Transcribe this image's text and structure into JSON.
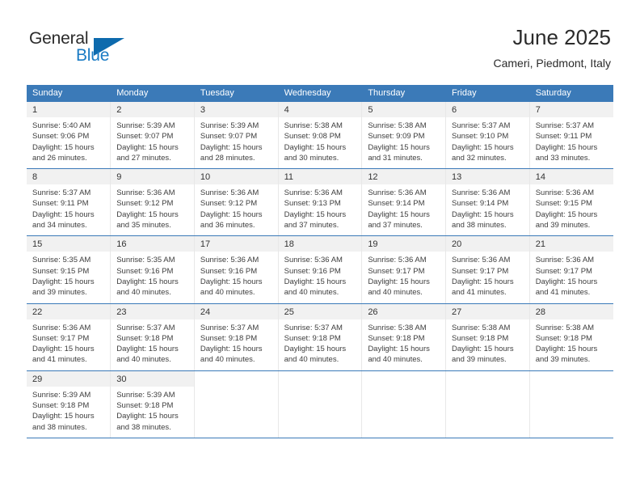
{
  "brand": {
    "name_part1": "General",
    "name_part2": "Blue",
    "logo_icon": "triangle-logo-icon",
    "accent_color": "#1a7bc4"
  },
  "header": {
    "title": "June 2025",
    "subtitle": "Cameri, Piedmont, Italy"
  },
  "theme": {
    "header_row_bg": "#3b7ab8",
    "daynum_bg": "#f1f1f1",
    "row_divider": "#3b7ab8",
    "text": "#3d3d3d"
  },
  "calendar": {
    "weekday_headers": [
      "Sunday",
      "Monday",
      "Tuesday",
      "Wednesday",
      "Thursday",
      "Friday",
      "Saturday"
    ],
    "weeks": [
      [
        {
          "day": "1",
          "sunrise": "Sunrise: 5:40 AM",
          "sunset": "Sunset: 9:06 PM",
          "daylight_line1": "Daylight: 15 hours",
          "daylight_line2": "and 26 minutes."
        },
        {
          "day": "2",
          "sunrise": "Sunrise: 5:39 AM",
          "sunset": "Sunset: 9:07 PM",
          "daylight_line1": "Daylight: 15 hours",
          "daylight_line2": "and 27 minutes."
        },
        {
          "day": "3",
          "sunrise": "Sunrise: 5:39 AM",
          "sunset": "Sunset: 9:07 PM",
          "daylight_line1": "Daylight: 15 hours",
          "daylight_line2": "and 28 minutes."
        },
        {
          "day": "4",
          "sunrise": "Sunrise: 5:38 AM",
          "sunset": "Sunset: 9:08 PM",
          "daylight_line1": "Daylight: 15 hours",
          "daylight_line2": "and 30 minutes."
        },
        {
          "day": "5",
          "sunrise": "Sunrise: 5:38 AM",
          "sunset": "Sunset: 9:09 PM",
          "daylight_line1": "Daylight: 15 hours",
          "daylight_line2": "and 31 minutes."
        },
        {
          "day": "6",
          "sunrise": "Sunrise: 5:37 AM",
          "sunset": "Sunset: 9:10 PM",
          "daylight_line1": "Daylight: 15 hours",
          "daylight_line2": "and 32 minutes."
        },
        {
          "day": "7",
          "sunrise": "Sunrise: 5:37 AM",
          "sunset": "Sunset: 9:11 PM",
          "daylight_line1": "Daylight: 15 hours",
          "daylight_line2": "and 33 minutes."
        }
      ],
      [
        {
          "day": "8",
          "sunrise": "Sunrise: 5:37 AM",
          "sunset": "Sunset: 9:11 PM",
          "daylight_line1": "Daylight: 15 hours",
          "daylight_line2": "and 34 minutes."
        },
        {
          "day": "9",
          "sunrise": "Sunrise: 5:36 AM",
          "sunset": "Sunset: 9:12 PM",
          "daylight_line1": "Daylight: 15 hours",
          "daylight_line2": "and 35 minutes."
        },
        {
          "day": "10",
          "sunrise": "Sunrise: 5:36 AM",
          "sunset": "Sunset: 9:12 PM",
          "daylight_line1": "Daylight: 15 hours",
          "daylight_line2": "and 36 minutes."
        },
        {
          "day": "11",
          "sunrise": "Sunrise: 5:36 AM",
          "sunset": "Sunset: 9:13 PM",
          "daylight_line1": "Daylight: 15 hours",
          "daylight_line2": "and 37 minutes."
        },
        {
          "day": "12",
          "sunrise": "Sunrise: 5:36 AM",
          "sunset": "Sunset: 9:14 PM",
          "daylight_line1": "Daylight: 15 hours",
          "daylight_line2": "and 37 minutes."
        },
        {
          "day": "13",
          "sunrise": "Sunrise: 5:36 AM",
          "sunset": "Sunset: 9:14 PM",
          "daylight_line1": "Daylight: 15 hours",
          "daylight_line2": "and 38 minutes."
        },
        {
          "day": "14",
          "sunrise": "Sunrise: 5:36 AM",
          "sunset": "Sunset: 9:15 PM",
          "daylight_line1": "Daylight: 15 hours",
          "daylight_line2": "and 39 minutes."
        }
      ],
      [
        {
          "day": "15",
          "sunrise": "Sunrise: 5:35 AM",
          "sunset": "Sunset: 9:15 PM",
          "daylight_line1": "Daylight: 15 hours",
          "daylight_line2": "and 39 minutes."
        },
        {
          "day": "16",
          "sunrise": "Sunrise: 5:35 AM",
          "sunset": "Sunset: 9:16 PM",
          "daylight_line1": "Daylight: 15 hours",
          "daylight_line2": "and 40 minutes."
        },
        {
          "day": "17",
          "sunrise": "Sunrise: 5:36 AM",
          "sunset": "Sunset: 9:16 PM",
          "daylight_line1": "Daylight: 15 hours",
          "daylight_line2": "and 40 minutes."
        },
        {
          "day": "18",
          "sunrise": "Sunrise: 5:36 AM",
          "sunset": "Sunset: 9:16 PM",
          "daylight_line1": "Daylight: 15 hours",
          "daylight_line2": "and 40 minutes."
        },
        {
          "day": "19",
          "sunrise": "Sunrise: 5:36 AM",
          "sunset": "Sunset: 9:17 PM",
          "daylight_line1": "Daylight: 15 hours",
          "daylight_line2": "and 40 minutes."
        },
        {
          "day": "20",
          "sunrise": "Sunrise: 5:36 AM",
          "sunset": "Sunset: 9:17 PM",
          "daylight_line1": "Daylight: 15 hours",
          "daylight_line2": "and 41 minutes."
        },
        {
          "day": "21",
          "sunrise": "Sunrise: 5:36 AM",
          "sunset": "Sunset: 9:17 PM",
          "daylight_line1": "Daylight: 15 hours",
          "daylight_line2": "and 41 minutes."
        }
      ],
      [
        {
          "day": "22",
          "sunrise": "Sunrise: 5:36 AM",
          "sunset": "Sunset: 9:17 PM",
          "daylight_line1": "Daylight: 15 hours",
          "daylight_line2": "and 41 minutes."
        },
        {
          "day": "23",
          "sunrise": "Sunrise: 5:37 AM",
          "sunset": "Sunset: 9:18 PM",
          "daylight_line1": "Daylight: 15 hours",
          "daylight_line2": "and 40 minutes."
        },
        {
          "day": "24",
          "sunrise": "Sunrise: 5:37 AM",
          "sunset": "Sunset: 9:18 PM",
          "daylight_line1": "Daylight: 15 hours",
          "daylight_line2": "and 40 minutes."
        },
        {
          "day": "25",
          "sunrise": "Sunrise: 5:37 AM",
          "sunset": "Sunset: 9:18 PM",
          "daylight_line1": "Daylight: 15 hours",
          "daylight_line2": "and 40 minutes."
        },
        {
          "day": "26",
          "sunrise": "Sunrise: 5:38 AM",
          "sunset": "Sunset: 9:18 PM",
          "daylight_line1": "Daylight: 15 hours",
          "daylight_line2": "and 40 minutes."
        },
        {
          "day": "27",
          "sunrise": "Sunrise: 5:38 AM",
          "sunset": "Sunset: 9:18 PM",
          "daylight_line1": "Daylight: 15 hours",
          "daylight_line2": "and 39 minutes."
        },
        {
          "day": "28",
          "sunrise": "Sunrise: 5:38 AM",
          "sunset": "Sunset: 9:18 PM",
          "daylight_line1": "Daylight: 15 hours",
          "daylight_line2": "and 39 minutes."
        }
      ],
      [
        {
          "day": "29",
          "sunrise": "Sunrise: 5:39 AM",
          "sunset": "Sunset: 9:18 PM",
          "daylight_line1": "Daylight: 15 hours",
          "daylight_line2": "and 38 minutes."
        },
        {
          "day": "30",
          "sunrise": "Sunrise: 5:39 AM",
          "sunset": "Sunset: 9:18 PM",
          "daylight_line1": "Daylight: 15 hours",
          "daylight_line2": "and 38 minutes."
        },
        {
          "day": "",
          "sunrise": "",
          "sunset": "",
          "daylight_line1": "",
          "daylight_line2": ""
        },
        {
          "day": "",
          "sunrise": "",
          "sunset": "",
          "daylight_line1": "",
          "daylight_line2": ""
        },
        {
          "day": "",
          "sunrise": "",
          "sunset": "",
          "daylight_line1": "",
          "daylight_line2": ""
        },
        {
          "day": "",
          "sunrise": "",
          "sunset": "",
          "daylight_line1": "",
          "daylight_line2": ""
        },
        {
          "day": "",
          "sunrise": "",
          "sunset": "",
          "daylight_line1": "",
          "daylight_line2": ""
        }
      ]
    ]
  }
}
